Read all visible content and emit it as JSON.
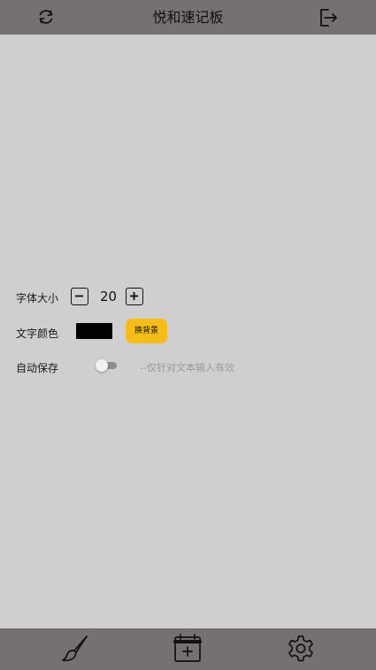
{
  "header": {
    "title": "悦和速记板",
    "left_icon": "refresh-icon",
    "right_icon": "logout-icon"
  },
  "settings": {
    "font_size": {
      "label": "字体大小",
      "value": "20",
      "decrement_icon": "minus-icon",
      "increment_icon": "plus-icon"
    },
    "text_color": {
      "label": "文字颜色",
      "color": "#000000",
      "bg_button_label": "换背景",
      "bg_button_color": "#f5bd16"
    },
    "autosave": {
      "label": "自动保存",
      "enabled": false,
      "hint": "--仅针对文本输入有效"
    }
  },
  "bottom_nav": {
    "items": [
      {
        "icon": "brush-icon"
      },
      {
        "icon": "calendar-add-icon"
      },
      {
        "icon": "gear-icon"
      }
    ]
  },
  "colors": {
    "bar_background": "#747170",
    "page_background": "#cfcfcf",
    "accent": "#f5bd16"
  }
}
